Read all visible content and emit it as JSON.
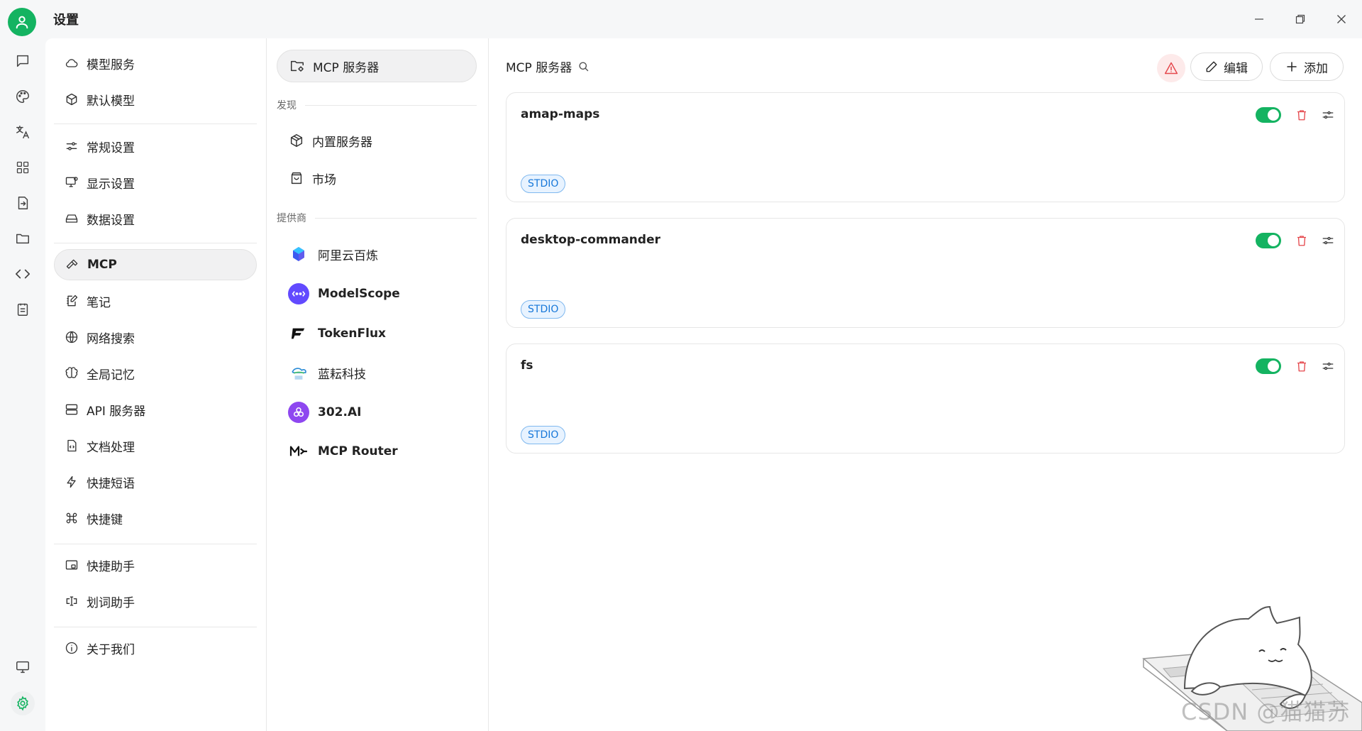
{
  "window": {
    "title": "设置"
  },
  "colors": {
    "accent": "#14b361",
    "danger": "#e5484d",
    "tag": "#1677d9"
  },
  "rail": {
    "icons": [
      "chat-icon",
      "palette-icon",
      "translate-icon",
      "apps-icon",
      "file-transfer-icon",
      "folder-icon",
      "code-icon",
      "notes-icon",
      "monitor-icon",
      "settings-gear-icon"
    ]
  },
  "nav": {
    "items": [
      {
        "label": "模型服务",
        "icon": "cloud-icon"
      },
      {
        "label": "默认模型",
        "icon": "cube-icon"
      },
      {
        "label": "常规设置",
        "icon": "sliders-icon"
      },
      {
        "label": "显示设置",
        "icon": "display-icon"
      },
      {
        "label": "数据设置",
        "icon": "hard-drive-icon"
      },
      {
        "label": "MCP",
        "icon": "hammer-icon"
      },
      {
        "label": "笔记",
        "icon": "notebook-pen-icon"
      },
      {
        "label": "网络搜索",
        "icon": "globe-icon"
      },
      {
        "label": "全局记忆",
        "icon": "brain-icon"
      },
      {
        "label": "API 服务器",
        "icon": "server-icon"
      },
      {
        "label": "文档处理",
        "icon": "file-code-icon"
      },
      {
        "label": "快捷短语",
        "icon": "zap-icon"
      },
      {
        "label": "快捷键",
        "icon": "command-icon"
      },
      {
        "label": "快捷助手",
        "icon": "app-window-icon"
      },
      {
        "label": "划词助手",
        "icon": "text-cursor-icon"
      },
      {
        "label": "关于我们",
        "icon": "info-icon"
      }
    ]
  },
  "sub": {
    "active": "MCP 服务器",
    "discover_heading": "发现",
    "discover": [
      {
        "label": "内置服务器",
        "icon": "package-icon"
      },
      {
        "label": "市场",
        "icon": "shopping-bag-icon"
      }
    ],
    "providers_heading": "提供商",
    "providers": [
      {
        "label": "阿里云百炼",
        "icon": "bailian-logo-icon",
        "color": "#615ced"
      },
      {
        "label": "ModelScope",
        "icon": "modelscope-logo-icon",
        "color": "#624aff"
      },
      {
        "label": "TokenFlux",
        "icon": "tokenflux-logo-icon",
        "color": "#111111"
      },
      {
        "label": "蓝耘科技",
        "icon": "lanyun-logo-icon",
        "color": "#2a8bd6"
      },
      {
        "label": "302.AI",
        "icon": "302ai-logo-icon",
        "color": "#8e47f0"
      },
      {
        "label": "MCP Router",
        "icon": "mcp-router-logo-icon",
        "color": "#111111"
      }
    ]
  },
  "main": {
    "title": "MCP 服务器",
    "edit_label": "编辑",
    "add_label": "添加",
    "servers": [
      {
        "name": "amap-maps",
        "type": "STDIO",
        "enabled": true
      },
      {
        "name": "desktop-commander",
        "type": "STDIO",
        "enabled": true
      },
      {
        "name": "fs",
        "type": "STDIO",
        "enabled": true
      }
    ]
  },
  "watermark": {
    "text": "CSDN @猫猫苏"
  }
}
